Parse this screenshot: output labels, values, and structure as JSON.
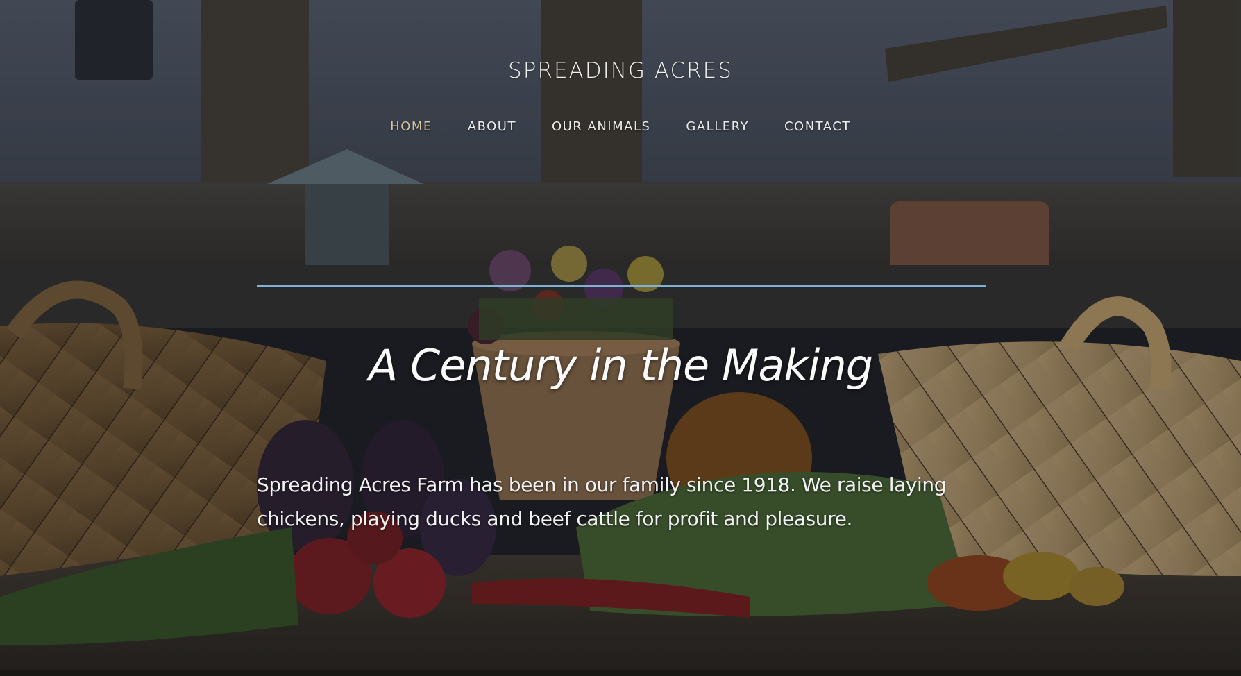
{
  "site": {
    "title": "SPREADING ACRES"
  },
  "nav": {
    "items": [
      {
        "label": "HOME",
        "active": true
      },
      {
        "label": "ABOUT",
        "active": false
      },
      {
        "label": "OUR ANIMALS",
        "active": false
      },
      {
        "label": "GALLERY",
        "active": false
      },
      {
        "label": "CONTACT",
        "active": false
      }
    ]
  },
  "hero": {
    "headline": "A Century in the Making",
    "intro": "Spreading Acres Farm has been in our family since 1918. We raise laying chickens, playing ducks and beef cattle for profit and pleasure."
  },
  "colors": {
    "accent_rule": "#7fb3d6",
    "active_nav": "#d8c3a5",
    "text": "#f1f1f1"
  },
  "icons": {
    "background": "farm-produce-photo"
  }
}
